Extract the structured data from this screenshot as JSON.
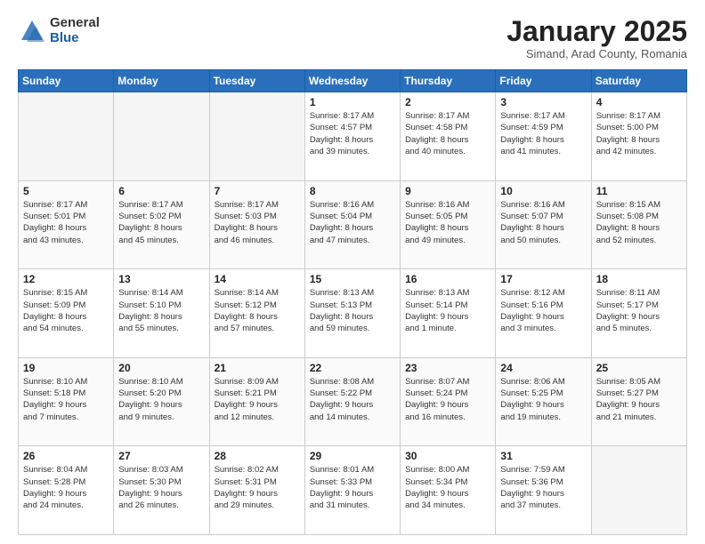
{
  "header": {
    "logo_general": "General",
    "logo_blue": "Blue",
    "month_title": "January 2025",
    "subtitle": "Simand, Arad County, Romania"
  },
  "weekdays": [
    "Sunday",
    "Monday",
    "Tuesday",
    "Wednesday",
    "Thursday",
    "Friday",
    "Saturday"
  ],
  "weeks": [
    [
      {
        "day": "",
        "info": ""
      },
      {
        "day": "",
        "info": ""
      },
      {
        "day": "",
        "info": ""
      },
      {
        "day": "1",
        "info": "Sunrise: 8:17 AM\nSunset: 4:57 PM\nDaylight: 8 hours\nand 39 minutes."
      },
      {
        "day": "2",
        "info": "Sunrise: 8:17 AM\nSunset: 4:58 PM\nDaylight: 8 hours\nand 40 minutes."
      },
      {
        "day": "3",
        "info": "Sunrise: 8:17 AM\nSunset: 4:59 PM\nDaylight: 8 hours\nand 41 minutes."
      },
      {
        "day": "4",
        "info": "Sunrise: 8:17 AM\nSunset: 5:00 PM\nDaylight: 8 hours\nand 42 minutes."
      }
    ],
    [
      {
        "day": "5",
        "info": "Sunrise: 8:17 AM\nSunset: 5:01 PM\nDaylight: 8 hours\nand 43 minutes."
      },
      {
        "day": "6",
        "info": "Sunrise: 8:17 AM\nSunset: 5:02 PM\nDaylight: 8 hours\nand 45 minutes."
      },
      {
        "day": "7",
        "info": "Sunrise: 8:17 AM\nSunset: 5:03 PM\nDaylight: 8 hours\nand 46 minutes."
      },
      {
        "day": "8",
        "info": "Sunrise: 8:16 AM\nSunset: 5:04 PM\nDaylight: 8 hours\nand 47 minutes."
      },
      {
        "day": "9",
        "info": "Sunrise: 8:16 AM\nSunset: 5:05 PM\nDaylight: 8 hours\nand 49 minutes."
      },
      {
        "day": "10",
        "info": "Sunrise: 8:16 AM\nSunset: 5:07 PM\nDaylight: 8 hours\nand 50 minutes."
      },
      {
        "day": "11",
        "info": "Sunrise: 8:15 AM\nSunset: 5:08 PM\nDaylight: 8 hours\nand 52 minutes."
      }
    ],
    [
      {
        "day": "12",
        "info": "Sunrise: 8:15 AM\nSunset: 5:09 PM\nDaylight: 8 hours\nand 54 minutes."
      },
      {
        "day": "13",
        "info": "Sunrise: 8:14 AM\nSunset: 5:10 PM\nDaylight: 8 hours\nand 55 minutes."
      },
      {
        "day": "14",
        "info": "Sunrise: 8:14 AM\nSunset: 5:12 PM\nDaylight: 8 hours\nand 57 minutes."
      },
      {
        "day": "15",
        "info": "Sunrise: 8:13 AM\nSunset: 5:13 PM\nDaylight: 8 hours\nand 59 minutes."
      },
      {
        "day": "16",
        "info": "Sunrise: 8:13 AM\nSunset: 5:14 PM\nDaylight: 9 hours\nand 1 minute."
      },
      {
        "day": "17",
        "info": "Sunrise: 8:12 AM\nSunset: 5:16 PM\nDaylight: 9 hours\nand 3 minutes."
      },
      {
        "day": "18",
        "info": "Sunrise: 8:11 AM\nSunset: 5:17 PM\nDaylight: 9 hours\nand 5 minutes."
      }
    ],
    [
      {
        "day": "19",
        "info": "Sunrise: 8:10 AM\nSunset: 5:18 PM\nDaylight: 9 hours\nand 7 minutes."
      },
      {
        "day": "20",
        "info": "Sunrise: 8:10 AM\nSunset: 5:20 PM\nDaylight: 9 hours\nand 9 minutes."
      },
      {
        "day": "21",
        "info": "Sunrise: 8:09 AM\nSunset: 5:21 PM\nDaylight: 9 hours\nand 12 minutes."
      },
      {
        "day": "22",
        "info": "Sunrise: 8:08 AM\nSunset: 5:22 PM\nDaylight: 9 hours\nand 14 minutes."
      },
      {
        "day": "23",
        "info": "Sunrise: 8:07 AM\nSunset: 5:24 PM\nDaylight: 9 hours\nand 16 minutes."
      },
      {
        "day": "24",
        "info": "Sunrise: 8:06 AM\nSunset: 5:25 PM\nDaylight: 9 hours\nand 19 minutes."
      },
      {
        "day": "25",
        "info": "Sunrise: 8:05 AM\nSunset: 5:27 PM\nDaylight: 9 hours\nand 21 minutes."
      }
    ],
    [
      {
        "day": "26",
        "info": "Sunrise: 8:04 AM\nSunset: 5:28 PM\nDaylight: 9 hours\nand 24 minutes."
      },
      {
        "day": "27",
        "info": "Sunrise: 8:03 AM\nSunset: 5:30 PM\nDaylight: 9 hours\nand 26 minutes."
      },
      {
        "day": "28",
        "info": "Sunrise: 8:02 AM\nSunset: 5:31 PM\nDaylight: 9 hours\nand 29 minutes."
      },
      {
        "day": "29",
        "info": "Sunrise: 8:01 AM\nSunset: 5:33 PM\nDaylight: 9 hours\nand 31 minutes."
      },
      {
        "day": "30",
        "info": "Sunrise: 8:00 AM\nSunset: 5:34 PM\nDaylight: 9 hours\nand 34 minutes."
      },
      {
        "day": "31",
        "info": "Sunrise: 7:59 AM\nSunset: 5:36 PM\nDaylight: 9 hours\nand 37 minutes."
      },
      {
        "day": "",
        "info": ""
      }
    ]
  ]
}
